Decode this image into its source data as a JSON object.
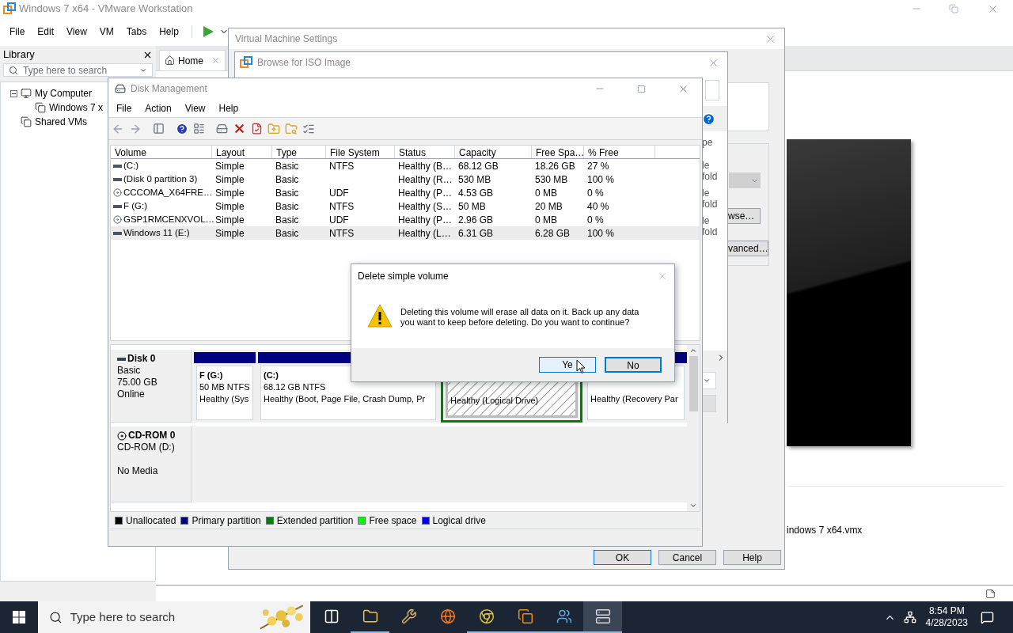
{
  "vmware": {
    "title": "Windows 7 x64 - VMware Workstation",
    "menu": [
      "File",
      "Edit",
      "View",
      "VM",
      "Tabs",
      "Help"
    ],
    "library": {
      "title": "Library",
      "search_placeholder": "Type here to search",
      "tree": [
        {
          "label": "My Computer",
          "kind": "computer",
          "expanded": true,
          "children": [
            {
              "label": "Windows 7 x",
              "kind": "vm"
            }
          ]
        },
        {
          "label": "Shared VMs",
          "kind": "shared"
        }
      ]
    },
    "tabs": [
      {
        "label": "Home",
        "selected": true
      }
    ],
    "vm_file": "indows 7 x64.vmx"
  },
  "vm_settings": {
    "title": "Virtual Machine Settings",
    "browse_button": "wse…",
    "advanced_button": "vanced…",
    "buttons": [
      "OK",
      "Cancel",
      "Help"
    ]
  },
  "browse_iso": {
    "title": "Browse for ISO Image",
    "fragments": [
      "pe",
      "le fold",
      "le fold",
      "le fold"
    ]
  },
  "disk_management": {
    "title": "Disk Management",
    "menu": [
      "File",
      "Action",
      "View",
      "Help"
    ],
    "columns": [
      "Volume",
      "Layout",
      "Type",
      "File System",
      "Status",
      "Capacity",
      "Free Spa…",
      "% Free"
    ],
    "rows": [
      {
        "kind": "disk",
        "selected": false,
        "cells": [
          " (C:)",
          "Simple",
          "Basic",
          "NTFS",
          "Healthy (B…",
          "68.12 GB",
          "18.26 GB",
          "27 %"
        ]
      },
      {
        "kind": "disk",
        "selected": false,
        "cells": [
          "(Disk 0 partition 3)",
          "Simple",
          "Basic",
          "",
          "Healthy (R…",
          "530 MB",
          "530 MB",
          "100 %"
        ]
      },
      {
        "kind": "cd",
        "selected": false,
        "cells": [
          "CCCOMA_X64FRE…",
          "Simple",
          "Basic",
          "UDF",
          "Healthy (P…",
          "4.53 GB",
          "0 MB",
          "0 %"
        ]
      },
      {
        "kind": "disk",
        "selected": false,
        "cells": [
          "F (G:)",
          "Simple",
          "Basic",
          "NTFS",
          "Healthy (S…",
          "50 MB",
          "20 MB",
          "40 %"
        ]
      },
      {
        "kind": "cd",
        "selected": false,
        "cells": [
          "GSP1RMCENXVOL…",
          "Simple",
          "Basic",
          "UDF",
          "Healthy (P…",
          "2.96 GB",
          "0 MB",
          "0 %"
        ]
      },
      {
        "kind": "disk",
        "selected": true,
        "cells": [
          "Windows 11 (E:)",
          "Simple",
          "Basic",
          "NTFS",
          "Healthy (L…",
          "6.31 GB",
          "6.28 GB",
          "100 %"
        ]
      }
    ],
    "disks": [
      {
        "kind": "disk",
        "name": "Disk 0",
        "lines": [
          "Basic",
          "75.00 GB",
          "Online"
        ],
        "partitions": [
          {
            "kind": "primary",
            "selected": false,
            "name": "F  (G:)",
            "lines": [
              "50 MB NTFS",
              "Healthy (Sys"
            ]
          },
          {
            "kind": "primary",
            "selected": false,
            "name": "(C:)",
            "lines": [
              "68.12 GB NTFS",
              "Healthy (Boot, Page File, Crash Dump, Pr"
            ]
          },
          {
            "kind": "logical",
            "selected": true,
            "lines": [
              "Healthy (Logical Drive)"
            ]
          },
          {
            "kind": "primary",
            "selected": false,
            "lines": [
              "Healthy (Recovery Par"
            ]
          }
        ]
      },
      {
        "kind": "cd",
        "name": "CD-ROM 0",
        "lines": [
          "CD-ROM (D:)",
          "No Media"
        ]
      }
    ],
    "legend": [
      {
        "label": "Unallocated",
        "color": "#000000"
      },
      {
        "label": "Primary partition",
        "color": "#000080"
      },
      {
        "label": "Extended partition",
        "color": "#008000"
      },
      {
        "label": "Free space",
        "color": "#00ff00"
      },
      {
        "label": "Logical drive",
        "color": "#0000ff"
      }
    ]
  },
  "dialog": {
    "title": "Delete simple volume",
    "message": "Deleting this volume will erase all data on it. Back up any data you want to keep before deleting. Do you want to continue?",
    "buttons": [
      {
        "label": "Ye",
        "selected": true
      },
      {
        "label": "No",
        "selected": false
      }
    ]
  },
  "taskbar": {
    "search_placeholder": "Type here to search",
    "time": "8:54 PM",
    "date": "4/28/2023",
    "apps": [
      {
        "kind": "task-view",
        "running": false,
        "selected": false
      },
      {
        "kind": "folder",
        "running": true,
        "selected": false
      },
      {
        "kind": "tool",
        "running": false,
        "selected": false
      },
      {
        "kind": "firefox",
        "running": false,
        "selected": false
      },
      {
        "kind": "chrome",
        "running": true,
        "selected": false
      },
      {
        "kind": "vmware",
        "running": true,
        "selected": false
      },
      {
        "kind": "people",
        "running": true,
        "selected": false
      },
      {
        "kind": "disk",
        "running": true,
        "selected": true
      }
    ]
  }
}
